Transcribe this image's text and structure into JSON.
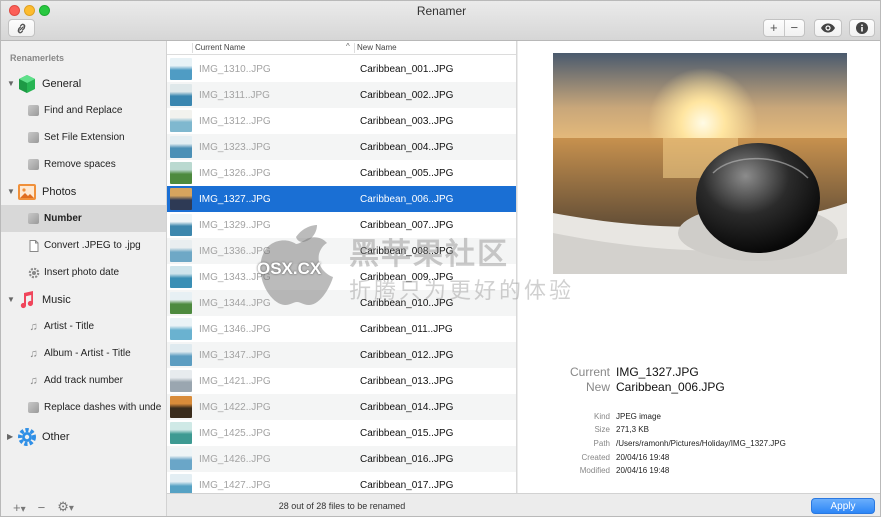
{
  "window": {
    "title": "Renamer"
  },
  "toolbar": {
    "add": "+",
    "remove": "−"
  },
  "sidebar": {
    "header": "Renamerlets",
    "groups": [
      {
        "label": "General",
        "color": "#2bc45b",
        "items": [
          "Find and Replace",
          "Set File Extension",
          "Remove spaces"
        ]
      },
      {
        "label": "Photos",
        "color": "#f0903a",
        "items": [
          "Number",
          "Convert .JPEG to .jpg",
          "Insert photo date"
        ]
      },
      {
        "label": "Music",
        "color": "#f0455b",
        "items": [
          "Artist - Title",
          "Album - Artist - Title",
          "Add track number",
          "Replace dashes with unde..."
        ]
      },
      {
        "label": "Other",
        "color": "#2f8fe6",
        "items": []
      }
    ],
    "selected_item": "Number",
    "bottom": {
      "add": "+",
      "add_menu": "▾",
      "remove": "−",
      "gear_menu": "▾"
    }
  },
  "list": {
    "col_current": "Current Name",
    "col_new": "New Name",
    "rows": [
      {
        "current": "IMG_1310..JPG",
        "new": "Caribbean_001..JPG"
      },
      {
        "current": "IMG_1311..JPG",
        "new": "Caribbean_002..JPG"
      },
      {
        "current": "IMG_1312..JPG",
        "new": "Caribbean_003..JPG"
      },
      {
        "current": "IMG_1323..JPG",
        "new": "Caribbean_004..JPG"
      },
      {
        "current": "IMG_1326..JPG",
        "new": "Caribbean_005..JPG"
      },
      {
        "current": "IMG_1327..JPG",
        "new": "Caribbean_006..JPG"
      },
      {
        "current": "IMG_1329..JPG",
        "new": "Caribbean_007..JPG"
      },
      {
        "current": "IMG_1336..JPG",
        "new": "Caribbean_008..JPG"
      },
      {
        "current": "IMG_1343..JPG",
        "new": "Caribbean_009..JPG"
      },
      {
        "current": "IMG_1344..JPG",
        "new": "Caribbean_010..JPG"
      },
      {
        "current": "IMG_1346..JPG",
        "new": "Caribbean_011..JPG"
      },
      {
        "current": "IMG_1347..JPG",
        "new": "Caribbean_012..JPG"
      },
      {
        "current": "IMG_1421..JPG",
        "new": "Caribbean_013..JPG"
      },
      {
        "current": "IMG_1422..JPG",
        "new": "Caribbean_014..JPG"
      },
      {
        "current": "IMG_1425..JPG",
        "new": "Caribbean_015..JPG"
      },
      {
        "current": "IMG_1426..JPG",
        "new": "Caribbean_016..JPG"
      },
      {
        "current": "IMG_1427..JPG",
        "new": "Caribbean_017..JPG"
      }
    ],
    "selected_index": 5
  },
  "preview": {
    "current_label": "Current",
    "current_value": "IMG_1327.JPG",
    "new_label": "New",
    "new_value": "Caribbean_006.JPG",
    "kind_label": "Kind",
    "kind_value": "JPEG image",
    "size_label": "Size",
    "size_value": "271,3 KB",
    "path_label": "Path",
    "path_value": "/Users/ramonh/Pictures/Holiday/IMG_1327.JPG",
    "created_label": "Created",
    "created_value": "20/04/16 19:48",
    "modified_label": "Modified",
    "modified_value": "20/04/16 19:48"
  },
  "footer": {
    "status": "28 out of 28 files to be renamed",
    "apply": "Apply"
  },
  "watermark": {
    "main": "黑苹果社区",
    "sub": "折腾只为更好的体验",
    "osx": "OSX.CX"
  },
  "colors": {
    "selection": "#1a6fd4",
    "apply": "#2d86f6"
  }
}
